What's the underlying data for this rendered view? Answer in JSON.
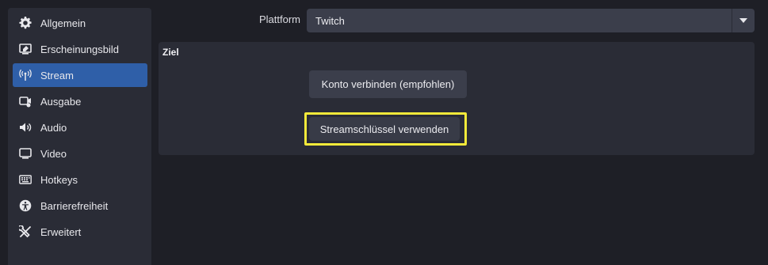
{
  "sidebar": {
    "items": [
      {
        "label": "Allgemein",
        "icon": "gear-icon",
        "active": false
      },
      {
        "label": "Erscheinungsbild",
        "icon": "appearance-icon",
        "active": false
      },
      {
        "label": "Stream",
        "icon": "antenna-icon",
        "active": true
      },
      {
        "label": "Ausgabe",
        "icon": "output-icon",
        "active": false
      },
      {
        "label": "Audio",
        "icon": "speaker-icon",
        "active": false
      },
      {
        "label": "Video",
        "icon": "monitor-icon",
        "active": false
      },
      {
        "label": "Hotkeys",
        "icon": "keyboard-icon",
        "active": false
      },
      {
        "label": "Barrierefreiheit",
        "icon": "accessibility-icon",
        "active": false
      },
      {
        "label": "Erweitert",
        "icon": "tools-icon",
        "active": false
      }
    ]
  },
  "platform": {
    "label": "Plattform",
    "value": "Twitch"
  },
  "destination": {
    "title": "Ziel",
    "connect_label": "Konto verbinden (empfohlen)",
    "stream_key_label": "Streamschlüssel verwenden"
  },
  "colors": {
    "background": "#1e1f26",
    "panel": "#2a2c36",
    "accent": "#2f5fa8",
    "highlight": "#f4ea3a"
  }
}
